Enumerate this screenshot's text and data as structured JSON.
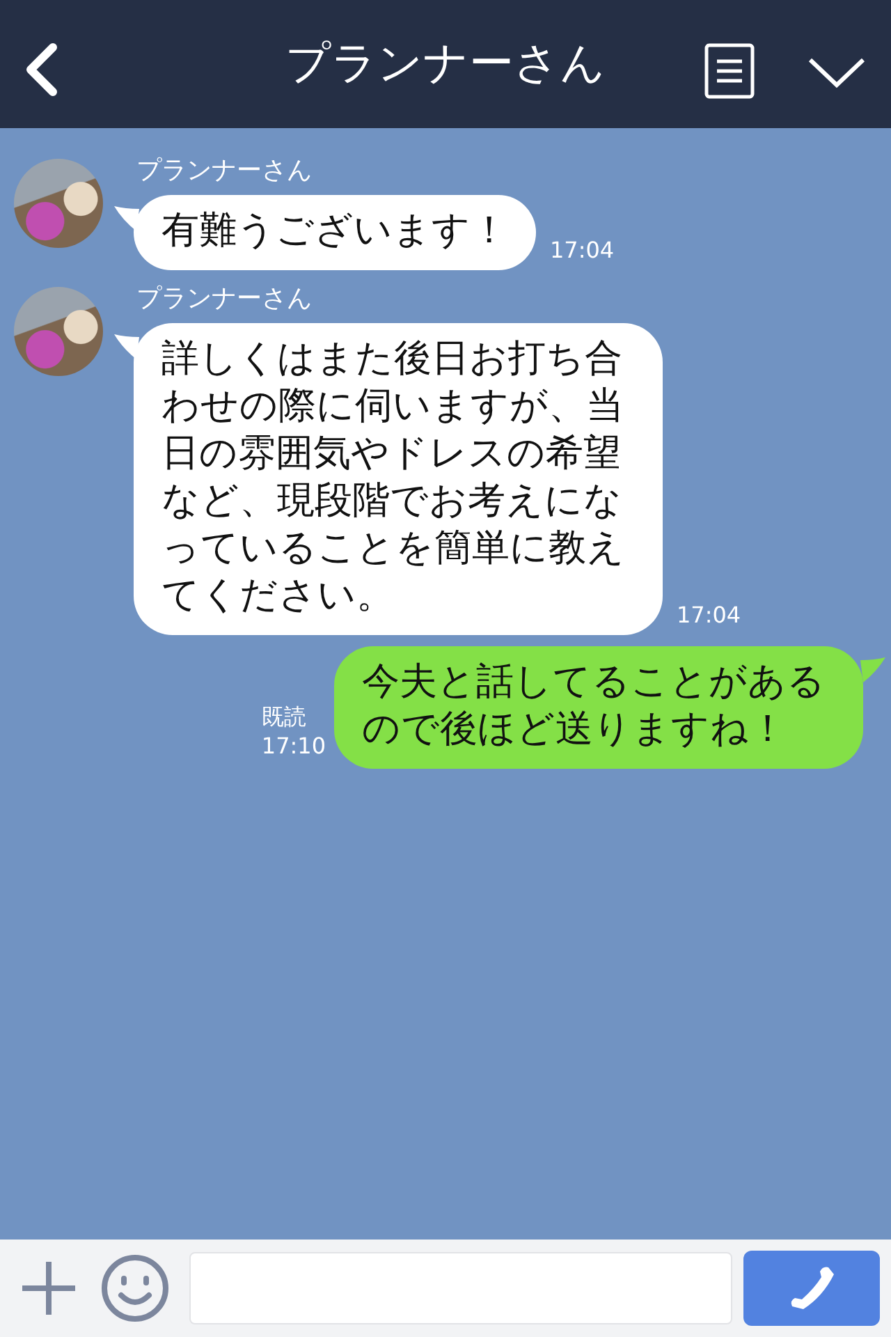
{
  "header": {
    "title": "プランナーさん"
  },
  "messages": [
    {
      "kind": "received",
      "sender": "プランナーさん",
      "text": "有難うございます！",
      "time": "17:04"
    },
    {
      "kind": "received",
      "sender": "プランナーさん",
      "text": "詳しくはまた後日お打ち合わせの際に伺いますが、当日の雰囲気やドレスの希望など、現段階でお考えになっていることを簡単に教えてください。",
      "time": "17:04"
    },
    {
      "kind": "sent",
      "text": "今夫と話してることがあるので後ほど送りますね！",
      "read": "既読",
      "time": "17:10"
    }
  ]
}
